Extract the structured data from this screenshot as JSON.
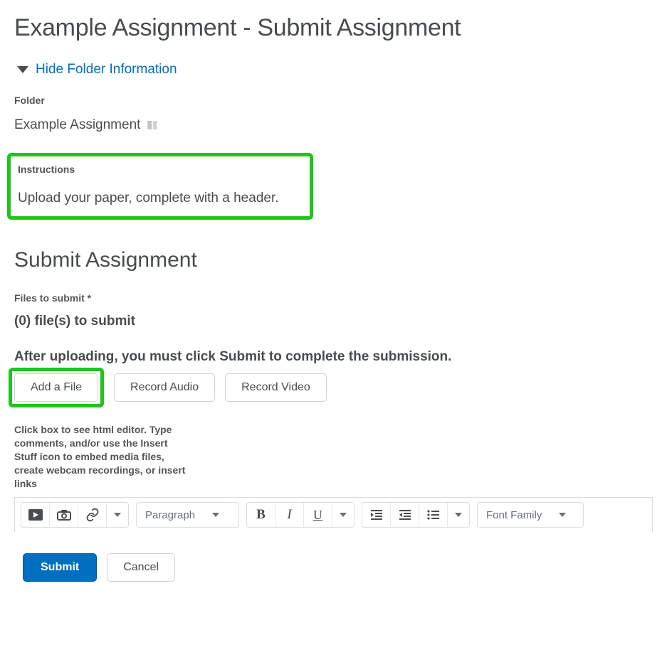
{
  "page_title": "Example Assignment - Submit Assignment",
  "folder_toggle_label": "Hide Folder Information",
  "labels": {
    "folder": "Folder",
    "instructions": "Instructions",
    "files_to_submit": "Files to submit *"
  },
  "folder_name": "Example Assignment",
  "instructions_text": "Upload your paper, complete with a header.",
  "section_heading": "Submit Assignment",
  "files_count_text": "(0) file(s) to submit",
  "submit_hint": "After uploading, you must click Submit to complete the submission.",
  "buttons": {
    "add_file": "Add a File",
    "record_audio": "Record Audio",
    "record_video": "Record Video",
    "submit": "Submit",
    "cancel": "Cancel"
  },
  "comments_hint": "Click box to see html editor. Type comments, and/or use the Insert Stuff icon to embed media files, create webcam recordings, or insert links",
  "editor": {
    "paragraph": "Paragraph",
    "font_family": "Font Family"
  }
}
